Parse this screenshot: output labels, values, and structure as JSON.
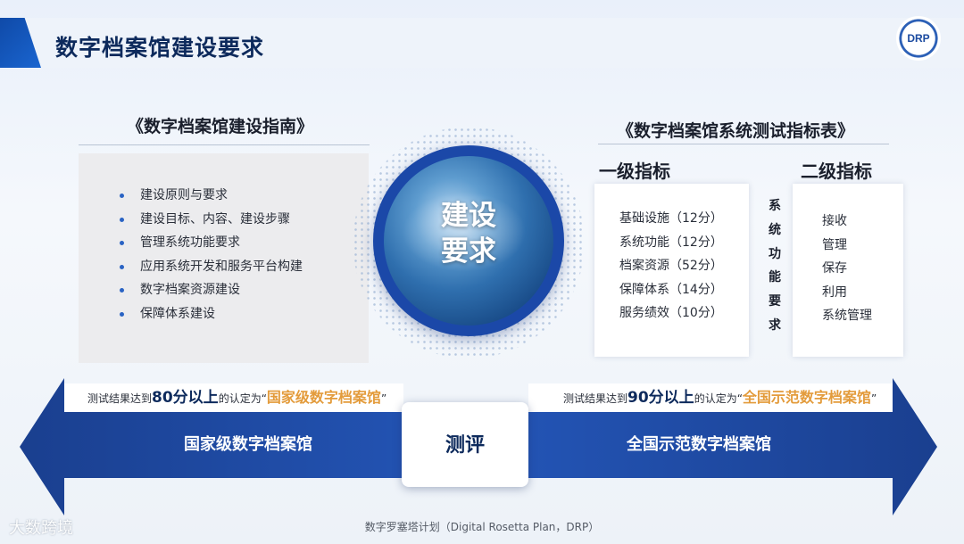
{
  "slide_title": "数字档案馆建设要求",
  "logo_text": "DRP",
  "left_panel": {
    "title": "《数字档案馆建设指南》",
    "items": [
      "建设原则与要求",
      "建设目标、内容、建设步骤",
      "管理系统功能要求",
      "应用系统开发和服务平台构建",
      "数字档案资源建设",
      "保障体系建设"
    ]
  },
  "center": {
    "line1": "建设",
    "line2": "要求"
  },
  "right_panel": {
    "title": "《数字档案馆系统测试指标表》",
    "level1_heading": "一级指标",
    "level2_heading": "二级指标",
    "level1_items": [
      "基础设施（12分）",
      "系统功能（12分）",
      "档案资源（52分）",
      "保障体系（14分）",
      "服务绩效（10分）"
    ],
    "vertical_label": [
      "系",
      "统",
      "功",
      "能",
      "要",
      "求"
    ],
    "level2_items": [
      "接收",
      "管理",
      "保存",
      "利用",
      "系统管理"
    ]
  },
  "evaluation": {
    "left_banner": {
      "prefix": "测试结果达到",
      "score": "80分以上",
      "middle": "的认定为",
      "quote_open": "“",
      "result": "国家级数字档案馆",
      "quote_close": "”"
    },
    "right_banner": {
      "prefix": "测试结果达到",
      "score": "90分以上",
      "middle": "的认定为",
      "quote_open": "“",
      "result": "全国示范数字档案馆",
      "quote_close": "”"
    },
    "left_arrow_label": "国家级数字档案馆",
    "center_label": "测评",
    "right_arrow_label": "全国示范数字档案馆"
  },
  "footer": "数字罗塞塔计划（Digital Rosetta Plan，DRP）",
  "watermark": "大数跨境",
  "colors": {
    "primary_blue": "#1b48a8",
    "accent_orange": "#e39b3b",
    "title_navy": "#0d2a5c"
  }
}
